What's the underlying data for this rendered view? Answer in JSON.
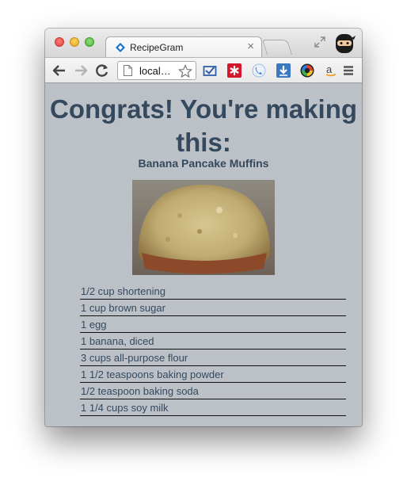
{
  "browser": {
    "tab_title": "RecipeGram",
    "tab_close": "×",
    "url": "local…",
    "icons": [
      "back-arrow-icon",
      "forward-arrow-icon",
      "reload-icon",
      "page-icon",
      "star-icon",
      "mail-check-icon",
      "asterisk-icon",
      "phone-icon",
      "download-icon",
      "color-wheel-icon",
      "amazon-icon",
      "menu-icon",
      "fullscreen-icon",
      "ninja-avatar-icon"
    ]
  },
  "page": {
    "heading": "Congrats! You're making this:",
    "recipe_name": "Banana Pancake Muffins",
    "ingredients": [
      "1/2 cup shortening",
      "1 cup brown sugar",
      "1 egg",
      "1 banana, diced",
      "3 cups all-purpose flour",
      "1 1/2 teaspoons baking powder",
      "1/2 teaspoon baking soda",
      "1 1/4 cups soy milk"
    ]
  },
  "colors": {
    "page_background": "#bcc1c8",
    "heading": "#34495e"
  }
}
